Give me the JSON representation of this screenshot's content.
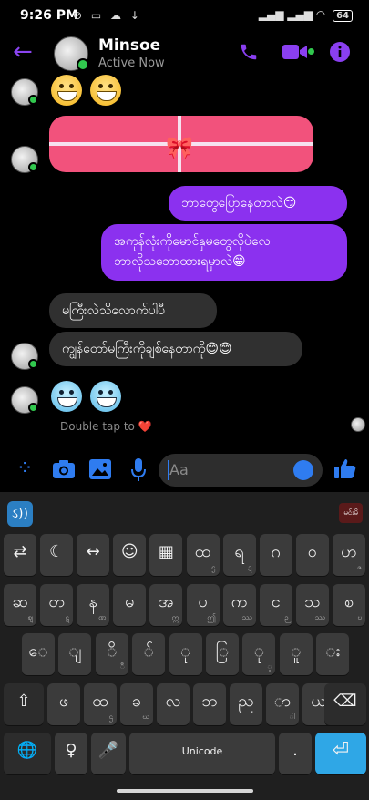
{
  "status_bar": {
    "time": "9:26 PM",
    "battery": "64"
  },
  "header": {
    "name": "Minsoe",
    "status": "Active Now"
  },
  "messages": {
    "out1": "ဘာတွေပြောနေတာလဲ😏",
    "out2_line1": "အကုန်လုံးကိုမောင်နှမတွေလိုပဲလေ",
    "out2_line2": "ဘာလိုသဘောထားရမှာလဲ😁",
    "in1": "မကြီးလဲသိလောက်ပါပီ",
    "in2": "ကျွန်တော်မကြီးကိုချစ်နေတာကို😊😊"
  },
  "double_tap": {
    "label": "Double tap to",
    "heart": "❤️"
  },
  "composer": {
    "placeholder": "Aa"
  },
  "keyboard": {
    "brand_badge": "မင်းမိ",
    "space_label": "Unicode",
    "row_tools": [
      {
        "name": "key-clipboard",
        "main": "⇄",
        "sub": ""
      },
      {
        "name": "key-theme",
        "main": "☾",
        "sub": ""
      },
      {
        "name": "key-cursor",
        "main": "↔",
        "sub": ""
      },
      {
        "name": "key-emoji",
        "main": "☺",
        "sub": ""
      },
      {
        "name": "key-numpad",
        "main": "▦",
        "sub": ""
      },
      {
        "name": "key-hta",
        "main": "ထ",
        "sub": "ဌ"
      },
      {
        "name": "key-ya",
        "main": "ရ",
        "sub": "ဍ"
      },
      {
        "name": "key-ga",
        "main": "ဂ",
        "sub": ""
      },
      {
        "name": "key-o",
        "main": "ဝ",
        "sub": ""
      },
      {
        "name": "key-ha",
        "main": "ဟ",
        "sub": "ဇ"
      }
    ],
    "row1": [
      {
        "name": "key-sa",
        "main": "ဆ",
        "sub": "ဈ"
      },
      {
        "name": "key-ta",
        "main": "တ",
        "sub": "ဋ"
      },
      {
        "name": "key-na",
        "main": "န",
        "sub": "ဏ"
      },
      {
        "name": "key-ma",
        "main": "မ",
        "sub": ""
      },
      {
        "name": "key-a",
        "main": "အ",
        "sub": "ဣ"
      },
      {
        "name": "key-pa",
        "main": "ပ",
        "sub": "ဤ"
      },
      {
        "name": "key-ka",
        "main": "က",
        "sub": "ဿ"
      },
      {
        "name": "key-nga",
        "main": "င",
        "sub": "ဉ"
      },
      {
        "name": "key-tha",
        "main": "သ",
        "sub": "ဿ"
      },
      {
        "name": "key-sa2",
        "main": "စ",
        "sub": "ဎ"
      }
    ],
    "row2": [
      {
        "name": "key-e",
        "main": "ေ",
        "sub": ""
      },
      {
        "name": "key-ya-pin",
        "main": "ျ",
        "sub": ""
      },
      {
        "name": "key-i",
        "main": "ိ",
        "sub": "ီ"
      },
      {
        "name": "key-asat",
        "main": "်",
        "sub": ""
      },
      {
        "name": "key-u",
        "main": "ု",
        "sub": ""
      },
      {
        "name": "key-ya-yit",
        "main": "ြ",
        "sub": ""
      },
      {
        "name": "key-u2",
        "main": "ု",
        "sub": "ူ"
      },
      {
        "name": "key-uu",
        "main": "ူ",
        "sub": ""
      },
      {
        "name": "key-visarga",
        "main": "း",
        "sub": ""
      }
    ],
    "row3": [
      {
        "name": "key-pha",
        "main": "ဖ",
        "sub": ""
      },
      {
        "name": "key-hta2",
        "main": "ထ",
        "sub": "ဌ"
      },
      {
        "name": "key-kha",
        "main": "ခ",
        "sub": "ဃ"
      },
      {
        "name": "key-la",
        "main": "လ",
        "sub": ""
      },
      {
        "name": "key-bha",
        "main": "ဘ",
        "sub": ""
      },
      {
        "name": "key-nya",
        "main": "ည",
        "sub": ""
      },
      {
        "name": "key-aa",
        "main": "ာ",
        "sub": "ါ"
      },
      {
        "name": "key-ya2",
        "main": "ယ",
        "sub": ""
      }
    ]
  }
}
